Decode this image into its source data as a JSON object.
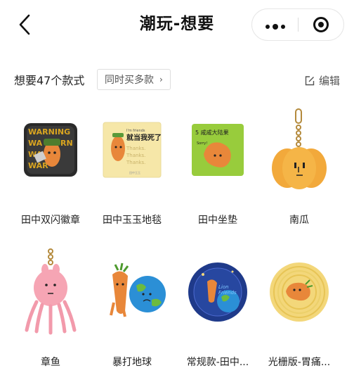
{
  "nav": {
    "title": "潮玩-想要",
    "back_icon": "chevron-left-icon",
    "more_icon": "more-dots-icon",
    "close_icon": "target-close-icon"
  },
  "subbar": {
    "count_text": "想要47个款式",
    "multi_buy_label": "同时买多款",
    "edit_label": "编辑",
    "edit_icon": "edit-icon"
  },
  "items": [
    {
      "name": "田中双闪徽章",
      "image": "badge-image"
    },
    {
      "name": "田中玉玉地毯",
      "image": "rug-image",
      "image_text": "就当我死了",
      "image_small": "I'm friends"
    },
    {
      "name": "田中坐垫",
      "image": "cushion-image",
      "image_text": "5 咸咸大陆果",
      "image_small": "Sorry!"
    },
    {
      "name": "南瓜",
      "image": "pumpkin-keychain-image"
    },
    {
      "name": "章鱼",
      "image": "octopus-keychain-image"
    },
    {
      "name": "暴打地球",
      "image": "carrot-earth-image"
    },
    {
      "name": "常规款-田中...",
      "image": "blue-plate-image"
    },
    {
      "name": "光栅版-胃痛...",
      "image": "gold-plate-image"
    }
  ],
  "colors": {
    "carrot": "#e8873a",
    "badge_dark": "#2a2a2a",
    "rug_bg": "#f6e7a8",
    "cushion_green": "#98cc3c",
    "pumpkin": "#f2a93b",
    "octopus_pink": "#f6a5b4",
    "earth_blue": "#2b8fd6",
    "plate_blue": "#1f3a8a",
    "plate_gold": "#f3d77a"
  }
}
